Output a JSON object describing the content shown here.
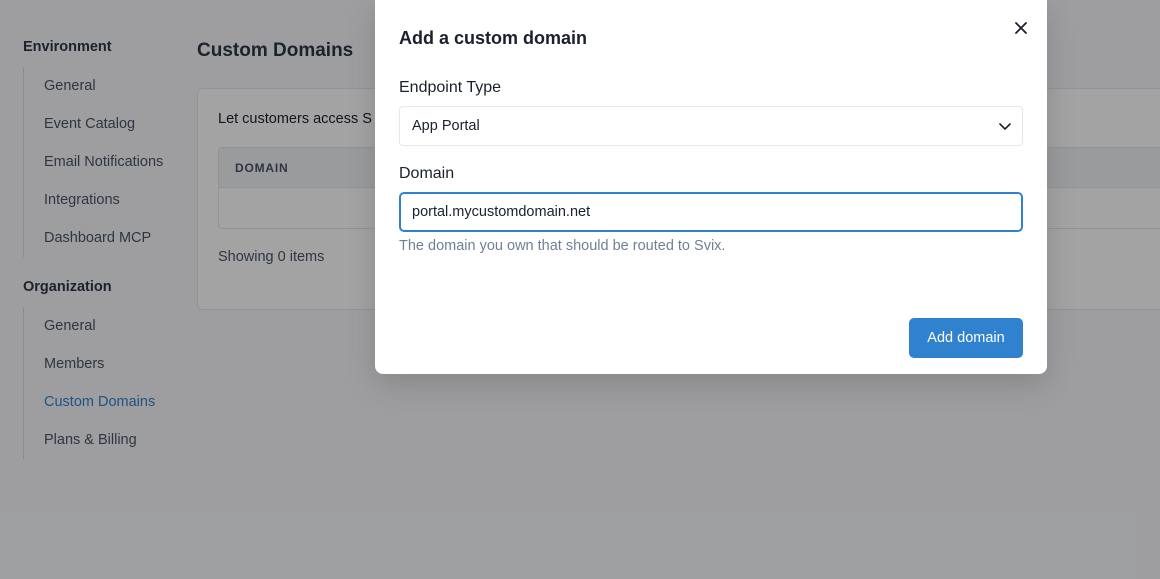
{
  "sidebar": {
    "sections": [
      {
        "title": "Environment",
        "items": [
          {
            "label": "General"
          },
          {
            "label": "Event Catalog"
          },
          {
            "label": "Email Notifications"
          },
          {
            "label": "Integrations"
          },
          {
            "label": "Dashboard MCP"
          }
        ]
      },
      {
        "title": "Organization",
        "items": [
          {
            "label": "General"
          },
          {
            "label": "Members"
          },
          {
            "label": "Custom Domains",
            "active": true
          },
          {
            "label": "Plans & Billing"
          }
        ]
      }
    ]
  },
  "main": {
    "title": "Custom Domains",
    "description": "Let customers access S",
    "table": {
      "columns": [
        "DOMAIN"
      ]
    },
    "footer": "Showing 0 items"
  },
  "modal": {
    "title": "Add a custom domain",
    "close_icon": "close-icon",
    "endpoint_type": {
      "label": "Endpoint Type",
      "value": "App Portal",
      "icon": "chevron-down-icon"
    },
    "domain": {
      "label": "Domain",
      "value": "portal.mycustomdomain.net",
      "helper": "The domain you own that should be routed to Svix."
    },
    "submit_label": "Add domain"
  },
  "colors": {
    "accent": "#3182ce",
    "overlay": "rgba(0,0,0,0.36)",
    "muted_text": "#718096"
  }
}
